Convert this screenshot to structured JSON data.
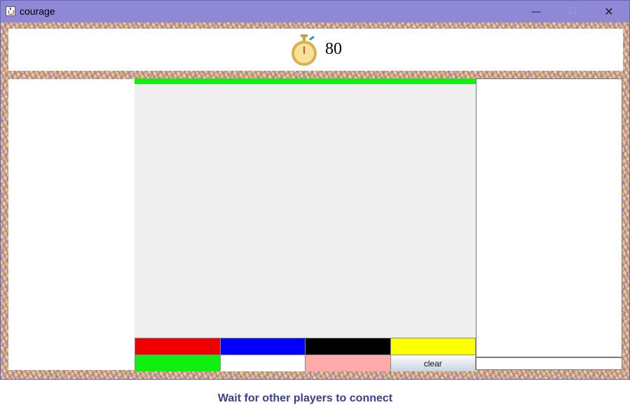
{
  "window": {
    "title": "courage",
    "app_icon": "java-cup-icon",
    "controls": {
      "minimize": "—",
      "maximize": "☐",
      "close": "✕"
    }
  },
  "timer": {
    "icon": "stopwatch-icon",
    "value": "80"
  },
  "round_progress": {
    "fraction_remaining": 1.0,
    "color": "#11ee11"
  },
  "palette": {
    "colors": [
      "#ee0000",
      "#0000ff",
      "#000000",
      "#ffff00",
      "#11ee11",
      "#ffffff",
      "#ffaaaa"
    ],
    "clear_label": "clear"
  },
  "chat": {
    "input_value": ""
  },
  "status": {
    "message": "Wait for  other players to connect",
    "color": "#3b3f8f"
  }
}
